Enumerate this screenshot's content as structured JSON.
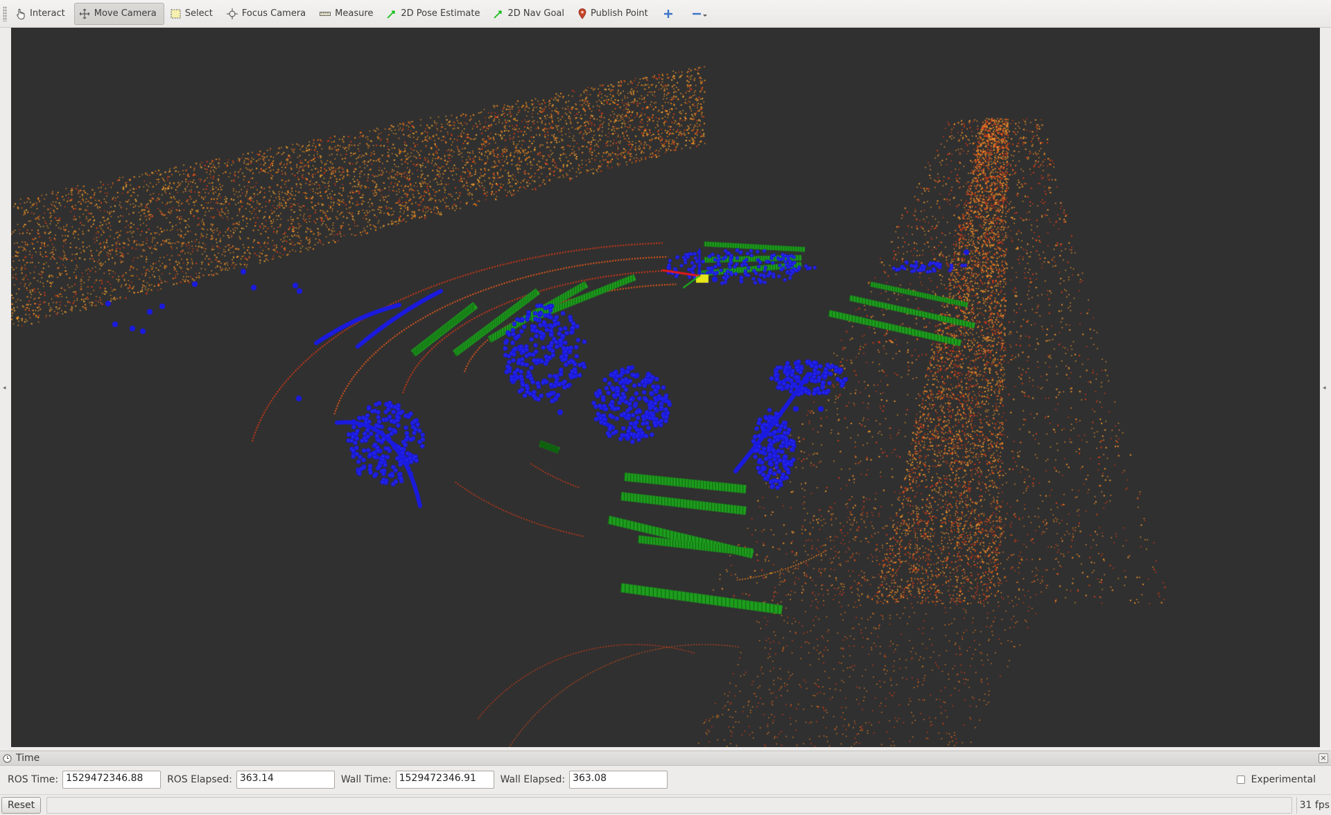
{
  "toolbar": {
    "tools": [
      {
        "label": "Interact",
        "icon": "hand-pointer-icon"
      },
      {
        "label": "Move Camera",
        "icon": "move-arrows-icon",
        "active": true
      },
      {
        "label": "Select",
        "icon": "selection-box-icon"
      },
      {
        "label": "Focus Camera",
        "icon": "crosshair-icon"
      },
      {
        "label": "Measure",
        "icon": "ruler-icon"
      },
      {
        "label": "2D Pose Estimate",
        "icon": "green-arrow-icon"
      },
      {
        "label": "2D Nav Goal",
        "icon": "green-arrow-icon"
      },
      {
        "label": "Publish Point",
        "icon": "map-pin-icon"
      }
    ],
    "add_tool_icon": "plus-icon",
    "remove_tool_icon": "minus-dropdown-icon"
  },
  "viewport": {
    "background": "#303030",
    "colors": {
      "far_points": "#e8861f",
      "near_points": "#d83a16",
      "obstacles_blue": "#1a1ae0",
      "obstacles_green": "#1e9e1e",
      "robot_marker": "#e6e61a"
    }
  },
  "time_panel": {
    "title": "Time",
    "ros_time_label": "ROS Time:",
    "ros_time": "1529472346.88",
    "ros_elapsed_label": "ROS Elapsed:",
    "ros_elapsed": "363.14",
    "wall_time_label": "Wall Time:",
    "wall_time": "1529472346.91",
    "wall_elapsed_label": "Wall Elapsed:",
    "wall_elapsed": "363.08",
    "experimental_label": "Experimental",
    "experimental_checked": false
  },
  "statusbar": {
    "reset_label": "Reset",
    "fps": "31 fps"
  }
}
